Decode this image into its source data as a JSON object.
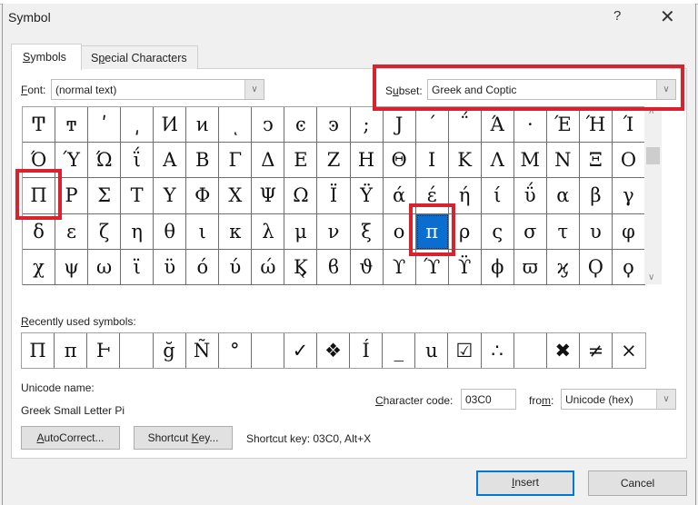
{
  "dialog": {
    "title": "Symbol",
    "help_label": "?",
    "close_label": "✕"
  },
  "tabs": [
    {
      "label_u": "S",
      "label_rest": "ymbols",
      "active": true
    },
    {
      "label_pre": "S",
      "label_u": "p",
      "label_rest": "ecial Characters",
      "active": false
    }
  ],
  "font": {
    "label_u": "F",
    "label_rest": "ont:",
    "value": "(normal text)"
  },
  "subset": {
    "label_pre": "S",
    "label_u": "u",
    "label_rest": "bset:",
    "value": "Greek and Coptic"
  },
  "grid": {
    "rows": [
      [
        "Ͳ",
        "ͳ",
        "ʹ",
        "͵",
        "Ͷ",
        "ͷ",
        "ͺ",
        "ͻ",
        "ͼ",
        "ͽ",
        ";",
        "Ϳ",
        "΄",
        "΅",
        "Ά",
        "·",
        "Έ",
        "Ή",
        "Ί"
      ],
      [
        "Ό",
        "Ύ",
        "Ώ",
        "ΐ",
        "Α",
        "Β",
        "Γ",
        "Δ",
        "Ε",
        "Ζ",
        "Η",
        "Θ",
        "Ι",
        "Κ",
        "Λ",
        "Μ",
        "Ν",
        "Ξ",
        "Ο"
      ],
      [
        "Π",
        "Ρ",
        "Σ",
        "Τ",
        "Υ",
        "Φ",
        "Χ",
        "Ψ",
        "Ω",
        "Ϊ",
        "Ϋ",
        "ά",
        "έ",
        "ή",
        "ί",
        "ΰ",
        "α",
        "β",
        "γ"
      ],
      [
        "δ",
        "ε",
        "ζ",
        "η",
        "θ",
        "ι",
        "κ",
        "λ",
        "μ",
        "ν",
        "ξ",
        "ο",
        "π",
        "ρ",
        "ς",
        "σ",
        "τ",
        "υ",
        "φ"
      ],
      [
        "χ",
        "ψ",
        "ω",
        "ϊ",
        "ϋ",
        "ό",
        "ύ",
        "ώ",
        "Ϗ",
        "ϐ",
        "ϑ",
        "ϒ",
        "ϓ",
        "ϔ",
        "ϕ",
        "ϖ",
        "ϗ",
        "Ϙ",
        "ϙ"
      ]
    ],
    "selected": {
      "row": 3,
      "col": 12
    }
  },
  "recent": {
    "label_u": "R",
    "label_rest": "ecently used symbols:",
    "symbols": [
      "Π",
      "π",
      "Ⱶ",
      "",
      "ğ",
      "Ñ",
      "°",
      "",
      "✓",
      "❖",
      "Í",
      "_",
      "u",
      "☑",
      "∴",
      "",
      "✖",
      "≠",
      "×"
    ]
  },
  "unicode": {
    "name_label": "Unicode name:",
    "name_value": "Greek Small Letter Pi"
  },
  "charcode": {
    "label_u": "C",
    "label_rest": "haracter code:",
    "value": "03C0"
  },
  "from": {
    "label_pre": "fro",
    "label_u": "m",
    "label_rest": ":",
    "value": "Unicode (hex)"
  },
  "buttons": {
    "autocorrect_u": "A",
    "autocorrect_rest": "utoCorrect...",
    "shortcut_pre": "Shortcut ",
    "shortcut_u": "K",
    "shortcut_rest": "ey...",
    "insert_u": "I",
    "insert_rest": "nsert",
    "cancel": "Cancel"
  },
  "shortcut_text": "Shortcut key: 03C0, Alt+X",
  "colors": {
    "highlight": "#d9222e",
    "selection": "#0a6ed1",
    "default_button_border": "#0078d7"
  }
}
